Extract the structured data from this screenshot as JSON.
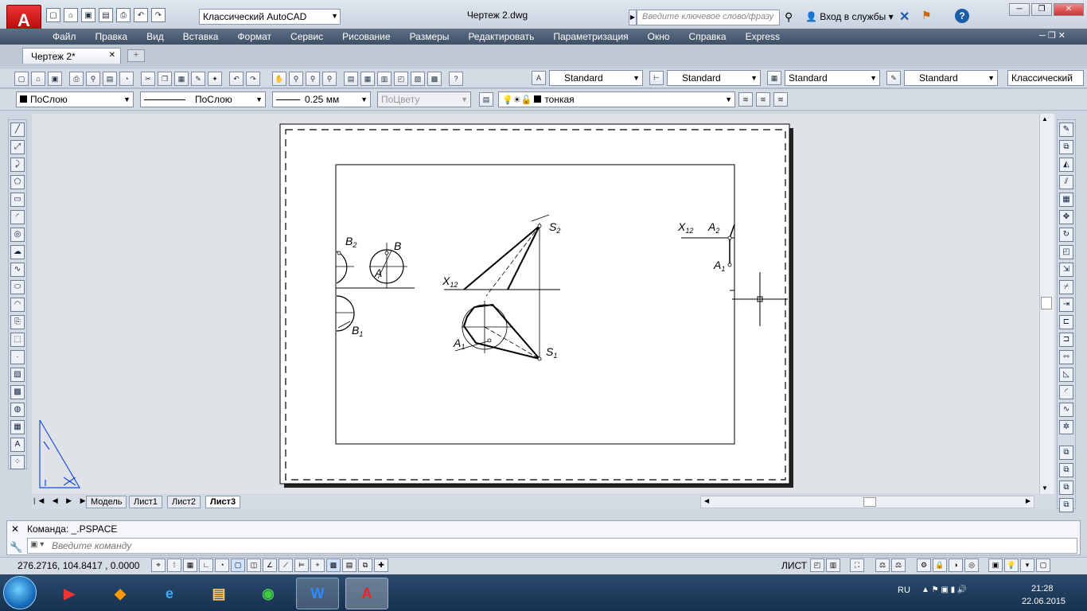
{
  "title_bar": {
    "workspace": "Классический AutoCAD",
    "document_title": "Чертеж 2.dwg",
    "search_placeholder": "Введите ключевое слово/фразу",
    "login": "Вход в службы"
  },
  "menu": [
    "Файл",
    "Правка",
    "Вид",
    "Вставка",
    "Формат",
    "Сервис",
    "Рисование",
    "Размеры",
    "Редактировать",
    "Параметризация",
    "Окно",
    "Справка",
    "Express"
  ],
  "doc_tab": "Чертеж 2*",
  "styles": {
    "text": "Standard",
    "dim": "Standard",
    "table": "Standard",
    "mleader": "Standard",
    "workspace2": "Классический"
  },
  "properties": {
    "color": "ПоСлою",
    "linetype": "ПоСлою",
    "lineweight": "0.25 мм",
    "plotstyle": "ПоЦвету",
    "layer": "тонкая"
  },
  "layout_tabs": [
    "Модель",
    "Лист1",
    "Лист2",
    "Лист3"
  ],
  "command": {
    "history": "Команда:  _.PSPACE",
    "placeholder": "Введите команду"
  },
  "status": {
    "coords": "276.2716, 104.8417 , 0.0000",
    "space": "ЛИСТ"
  },
  "drawing_labels": {
    "b2": "B",
    "b2_sub": "2",
    "b": "B",
    "a": "A",
    "b1": "B",
    "b1_sub": "1",
    "x12_left": "X",
    "x12_left_sub": "12",
    "s2": "S",
    "s2_sub": "2",
    "s1": "S",
    "s1_sub": "1",
    "a1": "A",
    "a1_sub": "1",
    "x12_right": "X",
    "x12_right_sub": "12",
    "a2_right": "A",
    "a2_right_sub": "2",
    "a1_right": "A",
    "a1_right_sub": "1"
  },
  "tray": {
    "lang": "RU",
    "time": "21:28",
    "date": "22.06.2015"
  }
}
